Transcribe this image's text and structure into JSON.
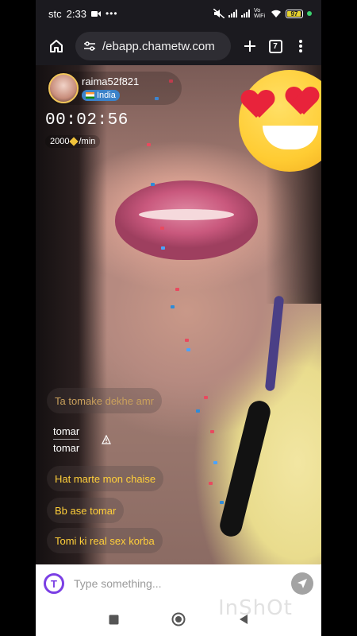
{
  "status_bar": {
    "carrier": "stc",
    "time": "2:33",
    "network_label": "Vo WiFi",
    "battery": "97"
  },
  "browser": {
    "url": "/ebapp.chametw.com",
    "tab_count": "7"
  },
  "host": {
    "username": "raima52f821",
    "country": "India",
    "call_timer": "00:02:56",
    "rate": "2000",
    "rate_unit": "/min"
  },
  "chat": {
    "messages": [
      "Ta tomake dekhe amr",
      "Hat marte mon chaise",
      "Bb ase tomar",
      "Tomi ki real sex korba"
    ],
    "translated": {
      "original": "tomar",
      "translation": "tomar"
    }
  },
  "input": {
    "placeholder": "Type something..."
  },
  "watermark": "InShOt",
  "colors": {
    "chat_text": "#ffcf3a",
    "accent_purple": "#7b3fe4",
    "country_badge": "#3b82c9"
  }
}
